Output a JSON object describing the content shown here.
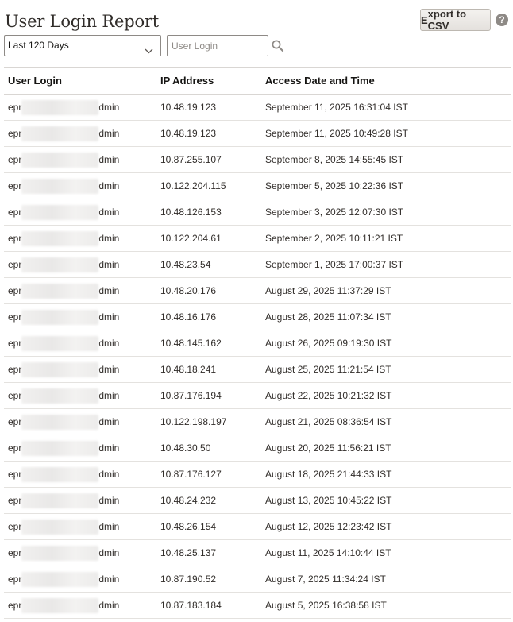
{
  "page": {
    "title": "User Login Report"
  },
  "toolbar": {
    "export_label_mnemonic": "E",
    "export_label_rest": "xport to CSV",
    "help_label": "?"
  },
  "filters": {
    "range_selected": "Last 120 Days",
    "user_login_placeholder": "User Login",
    "user_login_value": ""
  },
  "icons": {
    "dropdown": "chevron-down-icon",
    "search": "search-icon",
    "help": "help-icon"
  },
  "table": {
    "columns": [
      "User Login",
      "IP Address",
      "Access Date and Time"
    ],
    "rows": [
      {
        "login_start": "epr",
        "login_end": "dmin",
        "ip": "10.48.19.123",
        "access": "September 11, 2025 16:31:04 IST"
      },
      {
        "login_start": "epr",
        "login_end": "dmin",
        "ip": "10.48.19.123",
        "access": "September 11, 2025 10:49:28 IST"
      },
      {
        "login_start": "epr",
        "login_end": "dmin",
        "ip": "10.87.255.107",
        "access": "September 8, 2025 14:55:45 IST"
      },
      {
        "login_start": "epr",
        "login_end": "dmin",
        "ip": "10.122.204.115",
        "access": "September 5, 2025 10:22:36 IST"
      },
      {
        "login_start": "epr",
        "login_end": "dmin",
        "ip": "10.48.126.153",
        "access": "September 3, 2025 12:07:30 IST"
      },
      {
        "login_start": "epr",
        "login_end": "dmin",
        "ip": "10.122.204.61",
        "access": "September 2, 2025 10:11:21 IST"
      },
      {
        "login_start": "epr",
        "login_end": "dmin",
        "ip": "10.48.23.54",
        "access": "September 1, 2025 17:00:37 IST"
      },
      {
        "login_start": "epr",
        "login_end": "dmin",
        "ip": "10.48.20.176",
        "access": "August 29, 2025 11:37:29 IST"
      },
      {
        "login_start": "epr",
        "login_end": "dmin",
        "ip": "10.48.16.176",
        "access": "August 28, 2025 11:07:34 IST"
      },
      {
        "login_start": "epr",
        "login_end": "dmin",
        "ip": "10.48.145.162",
        "access": "August 26, 2025 09:19:30 IST"
      },
      {
        "login_start": "epr",
        "login_end": "dmin",
        "ip": "10.48.18.241",
        "access": "August 25, 2025 11:21:54 IST"
      },
      {
        "login_start": "epr",
        "login_end": "dmin",
        "ip": "10.87.176.194",
        "access": "August 22, 2025 10:21:32 IST"
      },
      {
        "login_start": "epr",
        "login_end": "dmin",
        "ip": "10.122.198.197",
        "access": "August 21, 2025 08:36:54 IST"
      },
      {
        "login_start": "epr",
        "login_end": "dmin",
        "ip": "10.48.30.50",
        "access": "August 20, 2025 11:56:21 IST"
      },
      {
        "login_start": "epr",
        "login_end": "dmin",
        "ip": "10.87.176.127",
        "access": "August 18, 2025 21:44:33 IST"
      },
      {
        "login_start": "epr",
        "login_end": "dmin",
        "ip": "10.48.24.232",
        "access": "August 13, 2025 10:45:22 IST"
      },
      {
        "login_start": "epr",
        "login_end": "dmin",
        "ip": "10.48.26.154",
        "access": "August 12, 2025 12:23:42 IST"
      },
      {
        "login_start": "epr",
        "login_end": "dmin",
        "ip": "10.48.25.137",
        "access": "August 11, 2025 14:10:44 IST"
      },
      {
        "login_start": "epr",
        "login_end": "dmin",
        "ip": "10.87.190.52",
        "access": "August 7, 2025 11:34:24 IST"
      },
      {
        "login_start": "epr",
        "login_end": "dmin",
        "ip": "10.87.183.184",
        "access": "August 5, 2025 16:38:58 IST"
      }
    ]
  }
}
